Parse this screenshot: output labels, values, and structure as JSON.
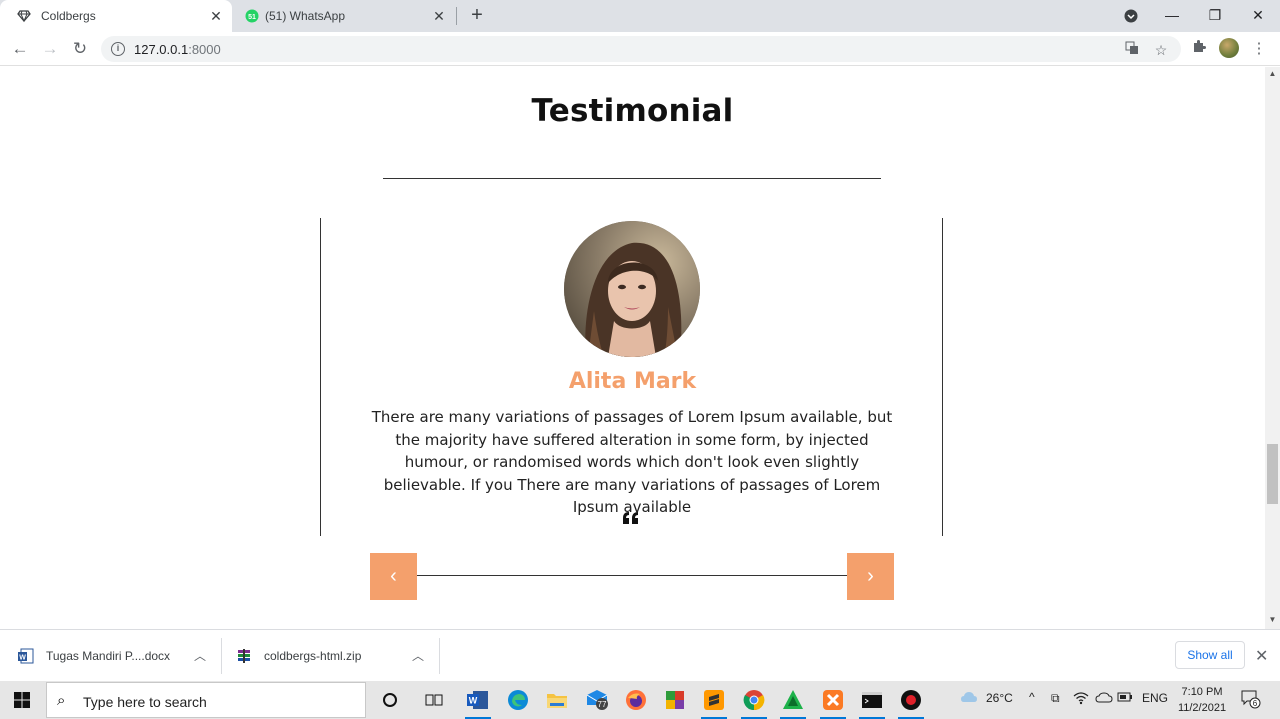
{
  "browser": {
    "tabs": [
      {
        "title": "Coldbergs",
        "active": true
      },
      {
        "title": "(51) WhatsApp",
        "active": false
      }
    ],
    "address": {
      "host": "127.0.0.1",
      "port": ":8000"
    }
  },
  "page": {
    "heading": "Testimonial",
    "testimonial": {
      "name": "Alita Mark",
      "text": "There are many variations of passages of Lorem Ipsum available, but the majority have suffered alteration in some form, by injected humour, or randomised words which don't look even slightly believable. If you There are many variations of passages of Lorem Ipsum available"
    },
    "prev_label": "‹",
    "next_label": "›"
  },
  "downloads": {
    "items": [
      {
        "name": "Tugas  Mandiri P....docx"
      },
      {
        "name": "coldbergs-html.zip"
      }
    ],
    "show_all": "Show all"
  },
  "taskbar": {
    "search_placeholder": "Type here to search",
    "mail_badge": "77",
    "weather": "26°C",
    "language": "ENG",
    "time": "7:10 PM",
    "date": "11/2/2021",
    "notification_count": "6"
  },
  "colors": {
    "accent": "#f4a06c",
    "tabstrip": "#dee1e6"
  }
}
